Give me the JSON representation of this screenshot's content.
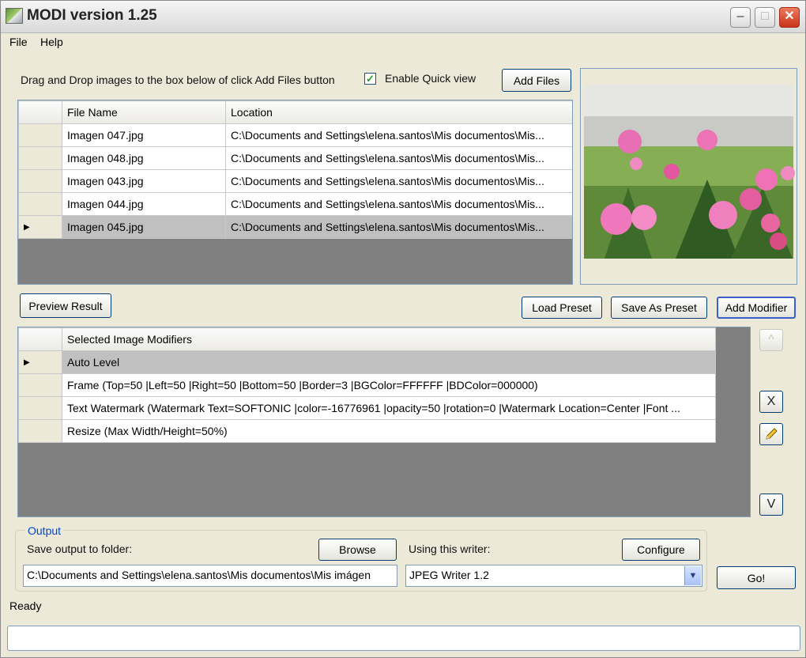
{
  "window": {
    "title": "MODI version 1.25",
    "min_icon": "minimize-icon",
    "max_icon": "maximize-icon",
    "close_icon": "close-icon"
  },
  "menu": {
    "items": [
      "File",
      "Help"
    ]
  },
  "top": {
    "instructions": "Drag and Drop images to the box below of click Add Files button",
    "quick_view_label": "Enable Quick view",
    "quick_view_checked": true,
    "add_files": "Add Files"
  },
  "files_table": {
    "columns": [
      "File Name",
      "Location"
    ],
    "rows": [
      {
        "name": "Imagen 047.jpg",
        "location": "C:\\Documents and Settings\\elena.santos\\Mis documentos\\Mis..."
      },
      {
        "name": "Imagen 048.jpg",
        "location": "C:\\Documents and Settings\\elena.santos\\Mis documentos\\Mis..."
      },
      {
        "name": "Imagen 043.jpg",
        "location": "C:\\Documents and Settings\\elena.santos\\Mis documentos\\Mis..."
      },
      {
        "name": "Imagen 044.jpg",
        "location": "C:\\Documents and Settings\\elena.santos\\Mis documentos\\Mis..."
      },
      {
        "name": "Imagen 045.jpg",
        "location": "C:\\Documents and Settings\\elena.santos\\Mis documentos\\Mis..."
      }
    ],
    "selected_index": 4,
    "row_pointer": "▶"
  },
  "buttons": {
    "preview_result": "Preview Result",
    "load_preset": "Load Preset",
    "save_as_preset": "Save As Preset",
    "add_modifier": "Add Modifier",
    "browse": "Browse",
    "configure": "Configure",
    "go": "Go!"
  },
  "modifiers_table": {
    "column": "Selected Image Modifiers",
    "rows": [
      "Auto Level",
      "Frame (Top=50 |Left=50 |Right=50 |Bottom=50 |Border=3 |BGColor=FFFFFF |BDColor=000000)",
      "Text Watermark (Watermark Text=SOFTONIC |color=-16776961 |opacity=50 |rotation=0 |Watermark Location=Center |Font ...",
      "Resize (Max Width/Height=50%)"
    ],
    "selected_index": 0
  },
  "side_buttons": {
    "up": "^",
    "remove": "X",
    "edit_icon": "pencil-icon",
    "down": "V"
  },
  "output": {
    "group_label": "Output",
    "folder_label": "Save output to folder:",
    "folder_value": "C:\\Documents and Settings\\elena.santos\\Mis documentos\\Mis imágen",
    "writer_label": "Using this writer:",
    "writer_value": "JPEG Writer 1.2"
  },
  "status": {
    "text": "Ready"
  },
  "colors": {
    "selected_row": "#c0c0c0",
    "grid_empty": "#808080",
    "window_bg": "#ece9d8"
  }
}
